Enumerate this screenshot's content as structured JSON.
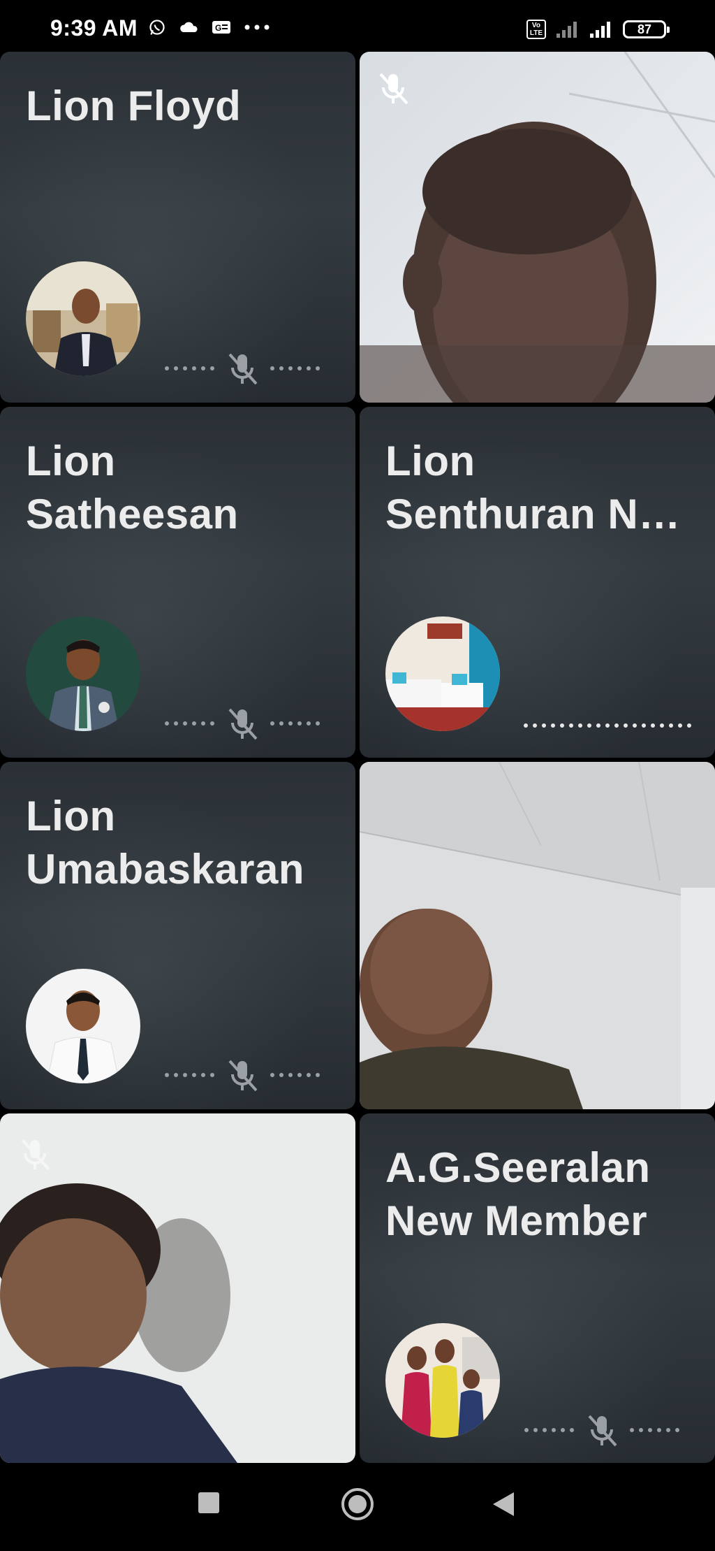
{
  "status_bar": {
    "time": "9:39 AM",
    "battery": "87",
    "volte": "Vo LTE",
    "icons": [
      "whatsapp-icon",
      "cloud-icon",
      "gallery-icon",
      "more-dots-icon",
      "signal-icon",
      "signal-icon"
    ]
  },
  "tiles": [
    {
      "name": "Lion Floyd",
      "type": "avatar",
      "muted": true
    },
    {
      "type": "video",
      "muted": true
    },
    {
      "name": "Lion\nSatheesan",
      "type": "avatar",
      "muted": true
    },
    {
      "name": "Lion\nSenthuran N…",
      "type": "avatar",
      "muted": false
    },
    {
      "name": "Lion\nUmabaskaran",
      "type": "avatar",
      "muted": true
    },
    {
      "type": "video",
      "muted": false
    },
    {
      "type": "video",
      "muted": true
    },
    {
      "name": "A.G.Seeralan\nNew Member",
      "type": "avatar",
      "muted": true
    }
  ],
  "nav": {
    "icons": [
      "recents-square-icon",
      "home-circle-icon",
      "back-triangle-icon"
    ]
  },
  "colors": {
    "tile_bg": "#2d3338",
    "muted_icon": "#9aa0a4"
  }
}
